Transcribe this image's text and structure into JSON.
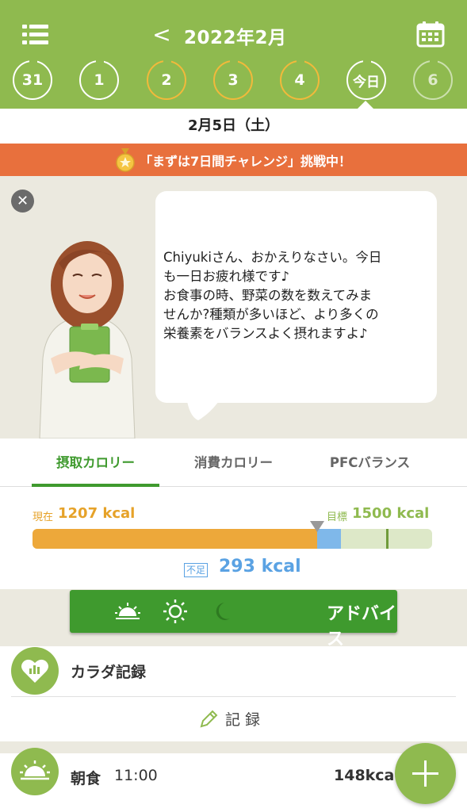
{
  "header": {
    "month_title": "2022年2月",
    "prev_symbol": "<",
    "days": [
      {
        "label": "31",
        "style": "white"
      },
      {
        "label": "1",
        "style": "white"
      },
      {
        "label": "2",
        "style": "orange"
      },
      {
        "label": "3",
        "style": "orange"
      },
      {
        "label": "4",
        "style": "orange"
      },
      {
        "label": "今日",
        "style": "today"
      },
      {
        "label": "6",
        "style": "faded"
      }
    ]
  },
  "date_bar": {
    "text": "2月5日（土）"
  },
  "challenge_banner": {
    "text": "「まずは7日間チャレンジ」挑戦中！"
  },
  "message": {
    "lines": [
      "Chiyukiさん、おかえりなさい。今日",
      "も一日お疲れ様です♪",
      "お食事の時、野菜の数を数えてみま",
      "せんか?種類が多いほど、より多くの",
      "栄養素をバランスよく摂れますよ♪"
    ]
  },
  "calorie_tabs": [
    "摂取カロリー",
    "消費カロリー",
    "PFCバランス"
  ],
  "calorie": {
    "current_label": "現在",
    "current_value": "1207 kcal",
    "target_label": "目標",
    "target_value": "1500 kcal",
    "deficit_label": "不足",
    "deficit_value": "293 kcal",
    "consumed_kcal": 1207,
    "target_kcal": 1500,
    "bar_max_kcal": 1695
  },
  "advice_button": {
    "label": "アドバイス"
  },
  "body_record": {
    "title": "カラダ記録",
    "record_label": "記録"
  },
  "breakfast": {
    "label": "朝食",
    "time": "11:00",
    "kcal": "148kcal"
  },
  "colors": {
    "header_green": "#8fba4f",
    "accent_green": "#3f9a2e",
    "banner_orange": "#e8703d",
    "calorie_orange": "#eda83a",
    "deficit_blue": "#5aa2e3"
  },
  "icons": [
    "menu-icon",
    "calendar-icon",
    "medal-icon",
    "close-icon",
    "sunrise-icon",
    "sun-icon",
    "moon-icon",
    "heart-chart-icon",
    "pencil-icon",
    "plus-icon"
  ]
}
